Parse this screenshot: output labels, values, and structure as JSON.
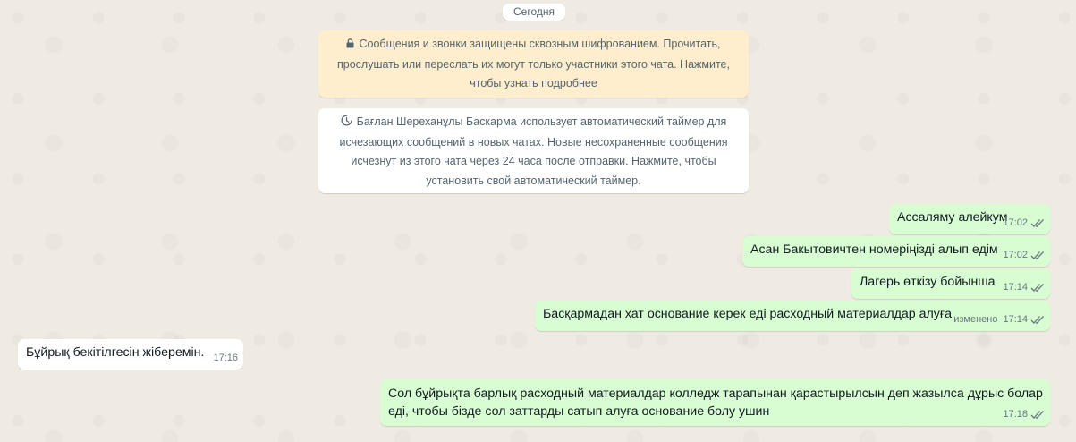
{
  "date_separator": "Сегодня",
  "system": {
    "encryption": {
      "line1": "Сообщения и звонки защищены сквозным шифрованием. Прочитать,",
      "line2": "прослушать или переслать их могут только участники этого чата. Нажмите,",
      "line3": "чтобы узнать подробнее",
      "icon": "lock-icon"
    },
    "timer": {
      "line1": "Бағлан Шереханұлы Баскарма использует автоматический таймер для",
      "line2": "исчезающих сообщений в новых чатах. Новые несохраненные сообщения",
      "line3": "исчезнут из этого чата через 24 часа после отправки. Нажмите, чтобы",
      "line4": "установить свой автоматический таймер.",
      "icon": "timer-icon"
    }
  },
  "messages": [
    {
      "direction": "out",
      "text": "Ассаляму алейкум",
      "time": "17:02",
      "status": "read"
    },
    {
      "direction": "out",
      "text": "Асан Бакытовичтен номеріңізді алып едім",
      "time": "17:02",
      "status": "read"
    },
    {
      "direction": "out",
      "text": "Лагерь өткізу бойынша",
      "time": "17:14",
      "status": "read"
    },
    {
      "direction": "out",
      "text": "Басқармадан хат основание керек еді расходный материалдар алуға",
      "time": "17:14",
      "edited": "изменено",
      "status": "read"
    },
    {
      "direction": "in",
      "text": "Бұйрық бекітілгесін жіберемін.",
      "time": "17:16"
    },
    {
      "direction": "out",
      "text": "Сол бұйрықта барлық расходный материалдар колледж тарапынан қарастырылсын деп жазылса дұрыс болар еді, чтобы бізде сол заттарды сатып алуға основание болу ушин",
      "time": "17:18",
      "status": "read"
    }
  ],
  "colors": {
    "chat_background": "#efeae2",
    "outgoing_bubble": "#d9fdd3",
    "incoming_bubble": "#ffffff",
    "encryption_notice": "#ffeecd",
    "read_tick": "#667781"
  }
}
